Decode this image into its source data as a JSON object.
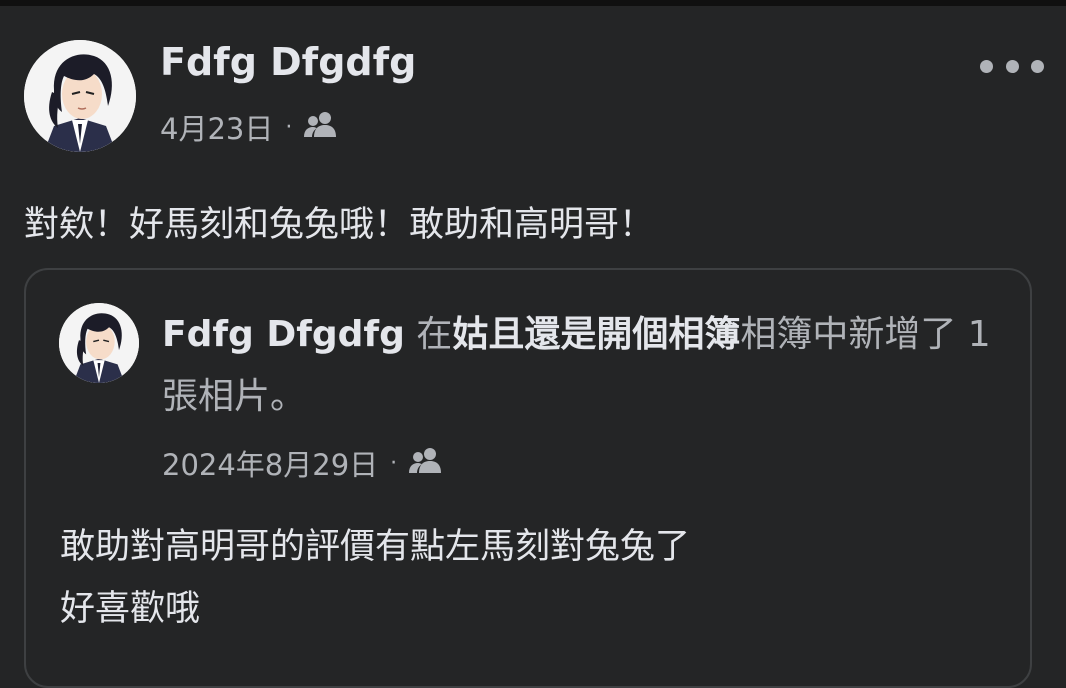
{
  "post": {
    "author": "Fdfg Dfgdfg",
    "date": "4月23日",
    "separator": "·",
    "audience_icon": "friends-icon",
    "more_icon": "more-options-icon",
    "text": "對欸！好馬刻和兔兔哦！敢助和高明哥！"
  },
  "shared_post": {
    "author": "Fdfg Dfgdfg",
    "action_prefix": "在",
    "album_name": "姑且還是開個相簿",
    "action_suffix": "相簿中新增了 1 張相片。",
    "date": "2024年8月29日",
    "separator": "·",
    "audience_icon": "friends-icon",
    "text_line1": "敢助對高明哥的評價有點左馬刻對兔兔了",
    "text_line2": "好喜歡哦"
  },
  "colors": {
    "background": "#242526",
    "primary_text": "#e4e6eb",
    "secondary_text": "#b0b3b8",
    "card_border": "#3e4042"
  }
}
